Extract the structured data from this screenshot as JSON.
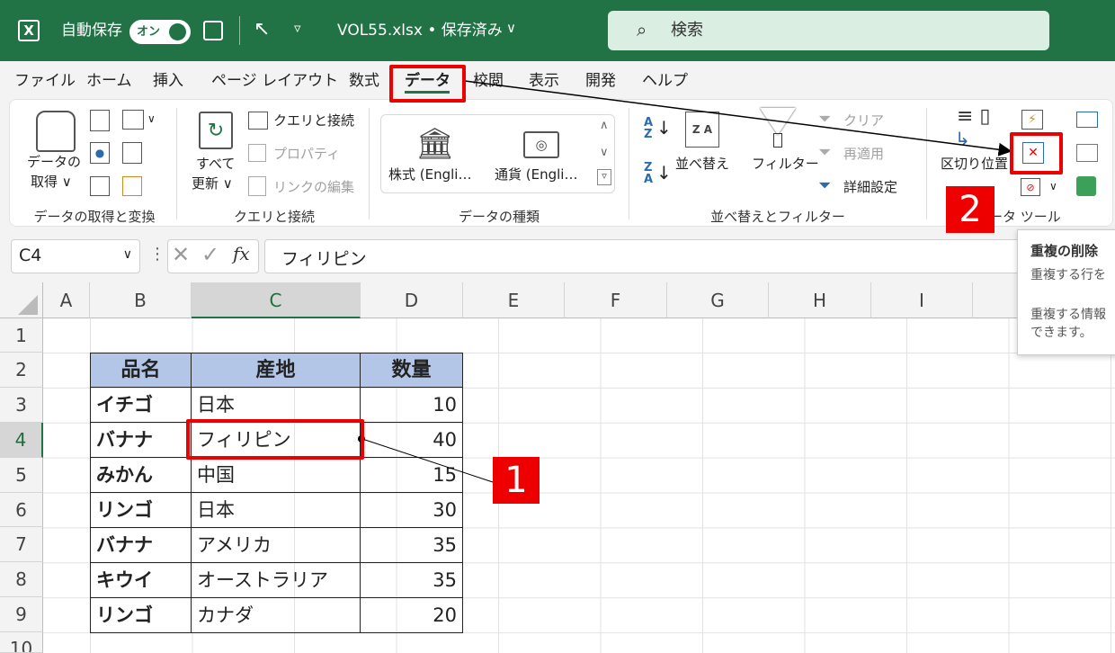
{
  "titlebar": {
    "autosave_label": "自動保存",
    "autosave_toggle": "オン",
    "filename": "VOL55.xlsx • 保存済み",
    "search_placeholder": "検索",
    "bg_color": "#217346"
  },
  "menu": [
    "ファイル",
    "ホーム",
    "挿入",
    "ページ レイアウト",
    "数式",
    "データ",
    "校閲",
    "表示",
    "開発",
    "ヘルプ"
  ],
  "active_menu": "データ",
  "ribbon": {
    "get_data": {
      "label1": "データの",
      "label2": "取得",
      "group": "データの取得と変換"
    },
    "queries": {
      "refresh1": "すべて",
      "refresh2": "更新",
      "queries_connections": "クエリと接続",
      "properties": "プロパティ",
      "edit_links": "リンクの編集",
      "group": "クエリと接続"
    },
    "data_types": {
      "stocks": "株式 (Engli…",
      "currency": "通貨 (Engli…",
      "group": "データの種類"
    },
    "sort_filter": {
      "sort": "並べ替え",
      "filter": "フィルター",
      "clear": "クリア",
      "reapply": "再適用",
      "advanced": "詳細設定",
      "group": "並べ替えとフィルター"
    },
    "data_tools": {
      "text_to_columns": "区切り位置",
      "group": "ータ ツール"
    }
  },
  "formula_bar": {
    "name_box": "C4",
    "formula": "フィリピン",
    "fx": "fx"
  },
  "columns": [
    "A",
    "B",
    "C",
    "D",
    "E",
    "F",
    "G",
    "H",
    "I"
  ],
  "selected_column": "C",
  "rows": [
    "1",
    "2",
    "3",
    "4",
    "5",
    "6",
    "7",
    "8",
    "9",
    "10"
  ],
  "selected_row": "4",
  "table": {
    "headers": [
      "品名",
      "産地",
      "数量"
    ],
    "rows": [
      [
        "イチゴ",
        "日本",
        "10"
      ],
      [
        "バナナ",
        "フィリピン",
        "40"
      ],
      [
        "みかん",
        "中国",
        "15"
      ],
      [
        "リンゴ",
        "日本",
        "30"
      ],
      [
        "バナナ",
        "アメリカ",
        "35"
      ],
      [
        "キウイ",
        "オーストラリア",
        "35"
      ],
      [
        "リンゴ",
        "カナダ",
        "20"
      ]
    ],
    "header_fill": "#b4c6e7"
  },
  "tooltip": {
    "title": "重複の削除",
    "line1": "重複する行を",
    "line2": "重複する情報",
    "line3": "できます。"
  },
  "callouts": {
    "step1": "1",
    "step2": "2",
    "color": "#e00000"
  }
}
